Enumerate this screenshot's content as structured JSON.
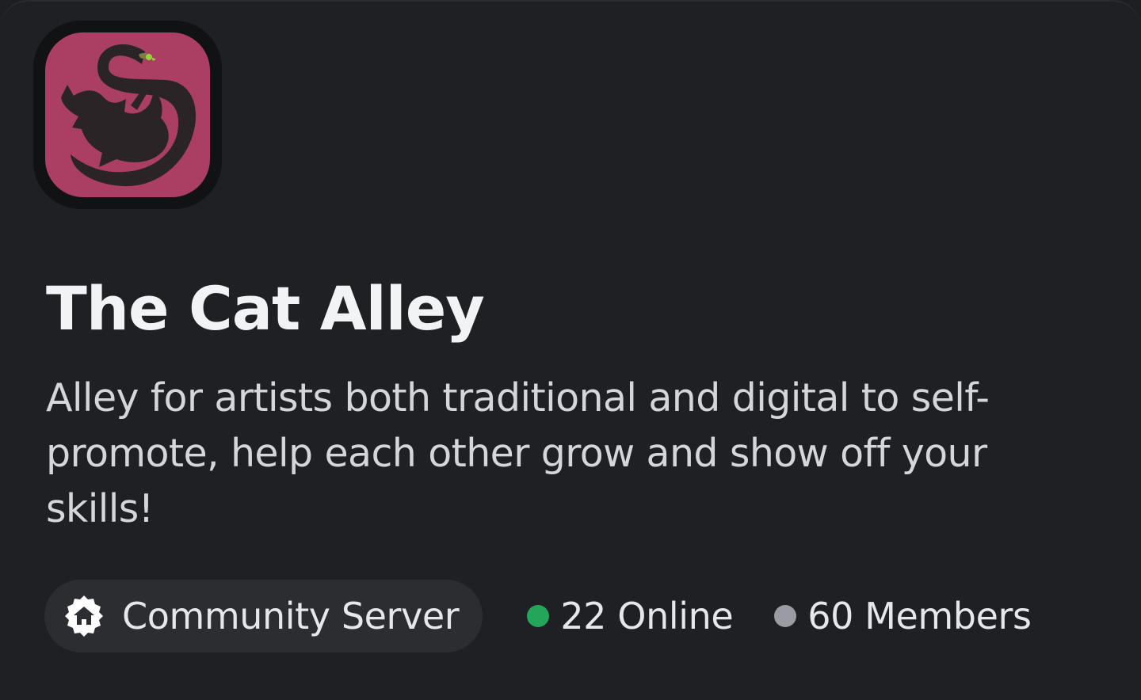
{
  "server": {
    "name": "The Cat Alley",
    "description": "Alley for artists both traditional and digital to self-promote, help each other grow and show off your skills!",
    "icon": "cat-alley-logo",
    "icon_bg_color": "#ab3f63"
  },
  "stats": {
    "community_label": "Community Server",
    "community_icon": "community-home-badge-icon",
    "online_text": "22 Online",
    "online_count": 22,
    "online_color": "#23a55a",
    "members_text": "60 Members",
    "members_count": 60,
    "members_color": "#9a9ba3"
  }
}
